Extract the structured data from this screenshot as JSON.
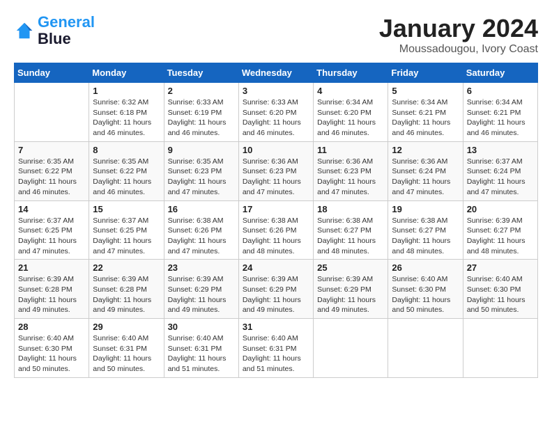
{
  "logo": {
    "line1": "General",
    "line2": "Blue"
  },
  "title": "January 2024",
  "subtitle": "Moussadougou, Ivory Coast",
  "days_of_week": [
    "Sunday",
    "Monday",
    "Tuesday",
    "Wednesday",
    "Thursday",
    "Friday",
    "Saturday"
  ],
  "weeks": [
    [
      {
        "day": "",
        "info": ""
      },
      {
        "day": "1",
        "info": "Sunrise: 6:32 AM\nSunset: 6:18 PM\nDaylight: 11 hours\nand 46 minutes."
      },
      {
        "day": "2",
        "info": "Sunrise: 6:33 AM\nSunset: 6:19 PM\nDaylight: 11 hours\nand 46 minutes."
      },
      {
        "day": "3",
        "info": "Sunrise: 6:33 AM\nSunset: 6:20 PM\nDaylight: 11 hours\nand 46 minutes."
      },
      {
        "day": "4",
        "info": "Sunrise: 6:34 AM\nSunset: 6:20 PM\nDaylight: 11 hours\nand 46 minutes."
      },
      {
        "day": "5",
        "info": "Sunrise: 6:34 AM\nSunset: 6:21 PM\nDaylight: 11 hours\nand 46 minutes."
      },
      {
        "day": "6",
        "info": "Sunrise: 6:34 AM\nSunset: 6:21 PM\nDaylight: 11 hours\nand 46 minutes."
      }
    ],
    [
      {
        "day": "7",
        "info": "Sunrise: 6:35 AM\nSunset: 6:22 PM\nDaylight: 11 hours\nand 46 minutes."
      },
      {
        "day": "8",
        "info": "Sunrise: 6:35 AM\nSunset: 6:22 PM\nDaylight: 11 hours\nand 46 minutes."
      },
      {
        "day": "9",
        "info": "Sunrise: 6:35 AM\nSunset: 6:23 PM\nDaylight: 11 hours\nand 47 minutes."
      },
      {
        "day": "10",
        "info": "Sunrise: 6:36 AM\nSunset: 6:23 PM\nDaylight: 11 hours\nand 47 minutes."
      },
      {
        "day": "11",
        "info": "Sunrise: 6:36 AM\nSunset: 6:23 PM\nDaylight: 11 hours\nand 47 minutes."
      },
      {
        "day": "12",
        "info": "Sunrise: 6:36 AM\nSunset: 6:24 PM\nDaylight: 11 hours\nand 47 minutes."
      },
      {
        "day": "13",
        "info": "Sunrise: 6:37 AM\nSunset: 6:24 PM\nDaylight: 11 hours\nand 47 minutes."
      }
    ],
    [
      {
        "day": "14",
        "info": "Sunrise: 6:37 AM\nSunset: 6:25 PM\nDaylight: 11 hours\nand 47 minutes."
      },
      {
        "day": "15",
        "info": "Sunrise: 6:37 AM\nSunset: 6:25 PM\nDaylight: 11 hours\nand 47 minutes."
      },
      {
        "day": "16",
        "info": "Sunrise: 6:38 AM\nSunset: 6:26 PM\nDaylight: 11 hours\nand 47 minutes."
      },
      {
        "day": "17",
        "info": "Sunrise: 6:38 AM\nSunset: 6:26 PM\nDaylight: 11 hours\nand 48 minutes."
      },
      {
        "day": "18",
        "info": "Sunrise: 6:38 AM\nSunset: 6:27 PM\nDaylight: 11 hours\nand 48 minutes."
      },
      {
        "day": "19",
        "info": "Sunrise: 6:38 AM\nSunset: 6:27 PM\nDaylight: 11 hours\nand 48 minutes."
      },
      {
        "day": "20",
        "info": "Sunrise: 6:39 AM\nSunset: 6:27 PM\nDaylight: 11 hours\nand 48 minutes."
      }
    ],
    [
      {
        "day": "21",
        "info": "Sunrise: 6:39 AM\nSunset: 6:28 PM\nDaylight: 11 hours\nand 49 minutes."
      },
      {
        "day": "22",
        "info": "Sunrise: 6:39 AM\nSunset: 6:28 PM\nDaylight: 11 hours\nand 49 minutes."
      },
      {
        "day": "23",
        "info": "Sunrise: 6:39 AM\nSunset: 6:29 PM\nDaylight: 11 hours\nand 49 minutes."
      },
      {
        "day": "24",
        "info": "Sunrise: 6:39 AM\nSunset: 6:29 PM\nDaylight: 11 hours\nand 49 minutes."
      },
      {
        "day": "25",
        "info": "Sunrise: 6:39 AM\nSunset: 6:29 PM\nDaylight: 11 hours\nand 49 minutes."
      },
      {
        "day": "26",
        "info": "Sunrise: 6:40 AM\nSunset: 6:30 PM\nDaylight: 11 hours\nand 50 minutes."
      },
      {
        "day": "27",
        "info": "Sunrise: 6:40 AM\nSunset: 6:30 PM\nDaylight: 11 hours\nand 50 minutes."
      }
    ],
    [
      {
        "day": "28",
        "info": "Sunrise: 6:40 AM\nSunset: 6:30 PM\nDaylight: 11 hours\nand 50 minutes."
      },
      {
        "day": "29",
        "info": "Sunrise: 6:40 AM\nSunset: 6:31 PM\nDaylight: 11 hours\nand 50 minutes."
      },
      {
        "day": "30",
        "info": "Sunrise: 6:40 AM\nSunset: 6:31 PM\nDaylight: 11 hours\nand 51 minutes."
      },
      {
        "day": "31",
        "info": "Sunrise: 6:40 AM\nSunset: 6:31 PM\nDaylight: 11 hours\nand 51 minutes."
      },
      {
        "day": "",
        "info": ""
      },
      {
        "day": "",
        "info": ""
      },
      {
        "day": "",
        "info": ""
      }
    ]
  ]
}
